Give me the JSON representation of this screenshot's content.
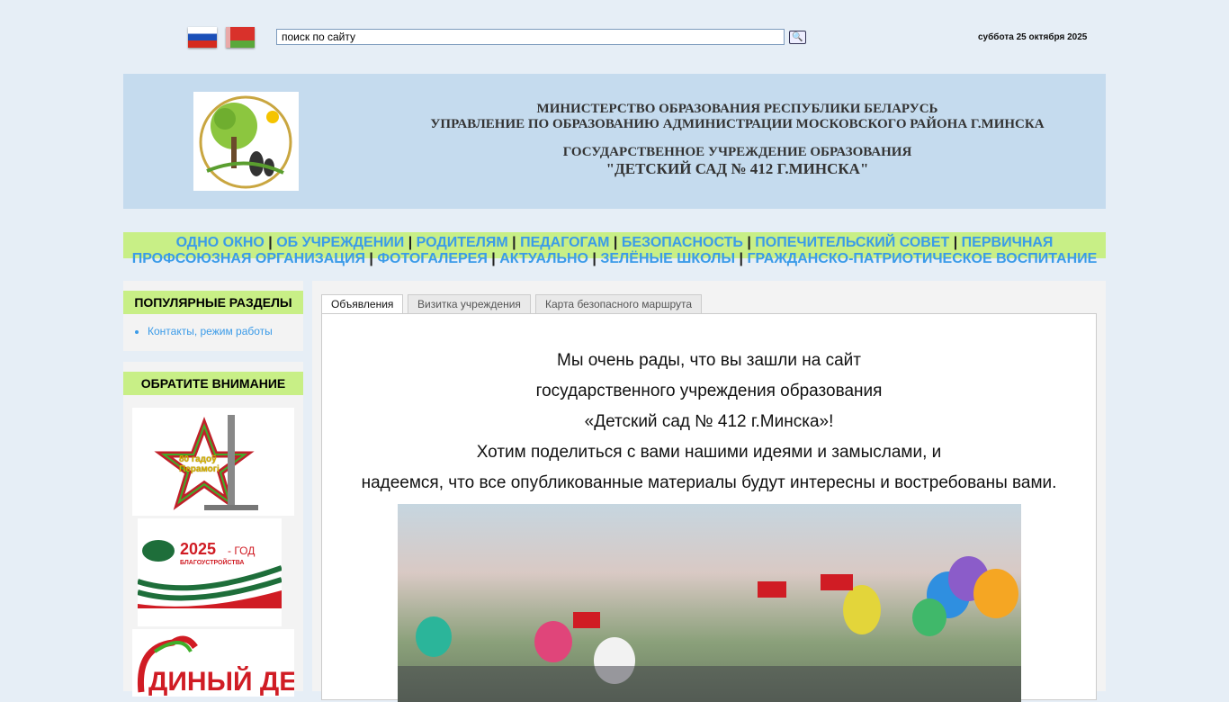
{
  "topbar": {
    "search_value": "поиск по сайту",
    "search_icon": "magnifier-icon",
    "date": "суббота 25 октября 2025",
    "flags": [
      "russian-flag",
      "belarus-flag"
    ]
  },
  "header": {
    "line1": "МИНИСТЕРСТВО ОБРАЗОВАНИЯ РЕСПУБЛИКИ БЕЛАРУСЬ",
    "line2": "УПРАВЛЕНИЕ ПО ОБРАЗОВАНИЮ АДМИНИСТРАЦИИ МОСКОВСКОГО РАЙОНА Г.МИНСКА",
    "line3": "ГОСУДАРСТВЕННОЕ УЧРЕЖДЕНИЕ ОБРАЗОВАНИЯ",
    "line4": "\"ДЕТСКИЙ САД № 412 Г.МИНСКА\"",
    "logo_text": "Детский сад № 412 г.Минска"
  },
  "menu": [
    "ОДНО ОКНО",
    "ОБ УЧРЕЖДЕНИИ",
    "РОДИТЕЛЯМ",
    "ПЕДАГОГАМ",
    "БЕЗОПАСНОСТЬ",
    "ПОПЕЧИТЕЛЬСКИЙ СОВЕТ",
    "ПЕРВИЧНАЯ ПРОФСОЮЗНАЯ ОРГАНИЗАЦИЯ",
    "ФОТОГАЛЕРЕЯ",
    "АКТУАЛЬНО",
    "ЗЕЛЁНЫЕ ШКОЛЫ",
    "ГРАЖДАНСКО-ПАТРИОТИЧЕСКОЕ ВОСПИТАНИЕ"
  ],
  "menu_separator": "|",
  "sidebar": {
    "popular_title": "ПОПУЛЯРНЫЕ РАЗДЕЛЫ",
    "popular_items": [
      "Контакты, режим работы"
    ],
    "attention_title": "ОБРАТИТЕ ВНИМАНИЕ",
    "banners": {
      "victory": "80 гадоў Перамогі",
      "year": "2025",
      "year_suffix": "- ГОД",
      "year_sub": "БЛАГОУСТРОЙСТВА",
      "unified_day": "ДИНЫЙ ДЕНЬ"
    }
  },
  "tabs": [
    "Объявления",
    "Визитка учреждения",
    "Карта безопасного маршрута"
  ],
  "content": {
    "lines": [
      "Мы очень рады, что вы зашли на сайт",
      "государственного учреждения образования",
      "«Детский сад № 412 г.Минска»!",
      "Хотим поделиться с вами нашими идеями и замыслами, и",
      "надеемся, что все опубликованные материалы будут интересны и востребованы вами."
    ]
  },
  "colors": {
    "accent_green": "#c8ef86",
    "link_blue": "#3b9be8",
    "header_bg": "#c5dbee",
    "page_bg": "#e6eef6"
  }
}
